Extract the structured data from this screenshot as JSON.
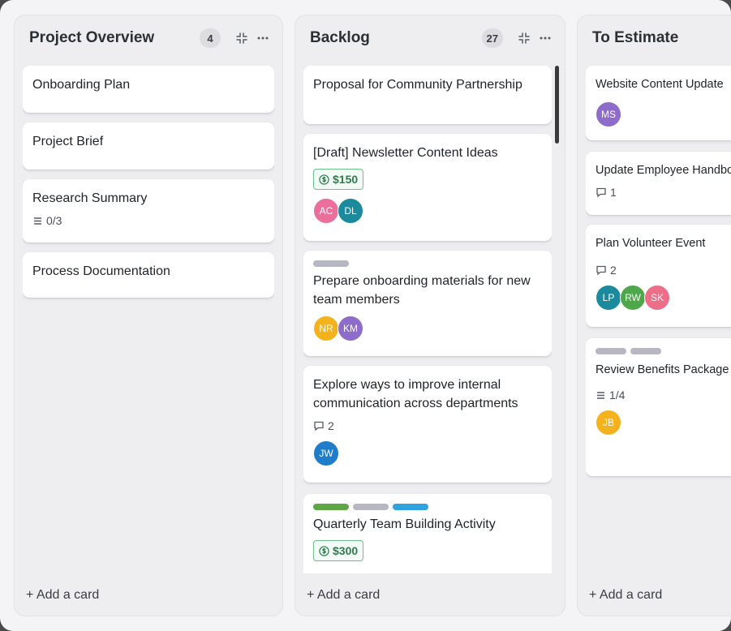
{
  "columns": [
    {
      "title": "Project Overview",
      "count": "4",
      "add_label": "+ Add a card",
      "cards": [
        {
          "title": "Onboarding Plan"
        },
        {
          "title": "Project Brief"
        },
        {
          "title": "Research Summary",
          "checklist": "0/3"
        },
        {
          "title": "Process Documentation"
        }
      ]
    },
    {
      "title": "Backlog",
      "count": "27",
      "add_label": "+ Add a card",
      "cards": [
        {
          "title": "Proposal for Community Partnership"
        },
        {
          "title": "[Draft] Newsletter Content Ideas",
          "price": "$150",
          "avatars": [
            "AC",
            "DL"
          ]
        },
        {
          "title": "Prepare onboarding materials for new team members",
          "avatars": [
            "NR",
            "KM"
          ]
        },
        {
          "title": "Explore ways to improve internal communication across departments",
          "comments": "2",
          "avatars": [
            "JW"
          ]
        },
        {
          "title": "Quarterly Team Building Activity",
          "price": "$300"
        }
      ]
    },
    {
      "title": "To Estimate",
      "add_label": "+ Add a card",
      "cards": [
        {
          "title": "Website Content Update",
          "avatars": [
            "MS"
          ]
        },
        {
          "title": "Update Employee Handbo",
          "comments": "1"
        },
        {
          "title": "Plan Volunteer Event",
          "comments": "2",
          "avatars": [
            "LP",
            "RW",
            "SK"
          ]
        },
        {
          "title": "Review Benefits Package Options",
          "checklist": "1/4",
          "avatars": [
            "JB"
          ]
        }
      ]
    }
  ],
  "avatar_colors": {
    "AC": "#ec6e9a",
    "DL": "#1a8a9c",
    "NR": "#f4b21c",
    "KM": "#8e6cc9",
    "JW": "#1f7dc9",
    "MS": "#8e6cc9",
    "LP": "#1a8a9c",
    "RW": "#4ea84a",
    "SK": "#ec6e88",
    "JB": "#f4b21c"
  },
  "label_colors": {
    "gray": "#b6b7c3",
    "green": "#5ea646",
    "blue": "#2ea3df"
  },
  "icons": [
    "collapse-icon",
    "more-icon",
    "checklist-icon",
    "comment-icon",
    "dollar-icon"
  ]
}
